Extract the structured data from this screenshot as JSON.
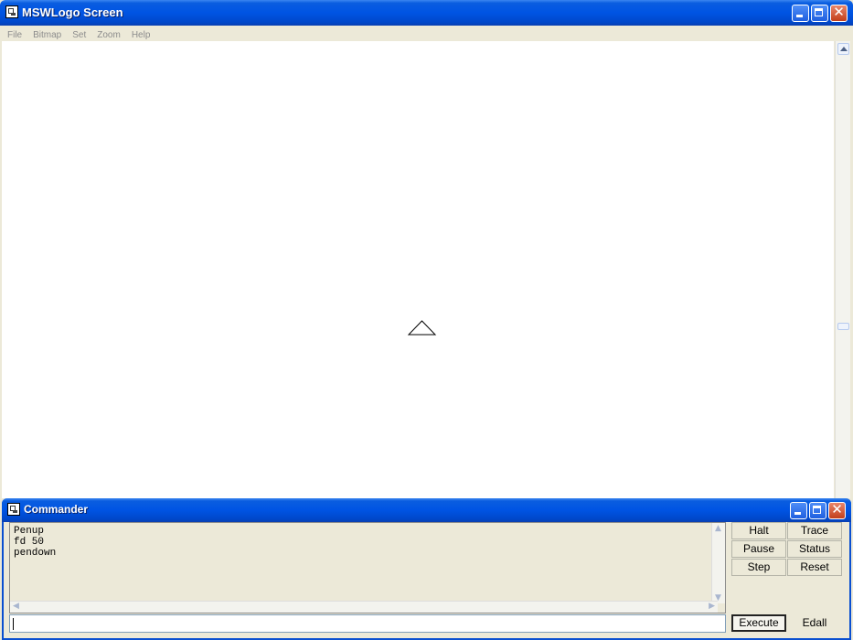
{
  "main_window": {
    "title": "MSWLogo Screen",
    "menu": [
      "File",
      "Bitmap",
      "Set",
      "Zoom",
      "Help"
    ]
  },
  "commander": {
    "title": "Commander",
    "history": [
      "Penup",
      "fd 50",
      "pendown"
    ],
    "input_value": "",
    "buttons": {
      "halt": "Halt",
      "trace": "Trace",
      "pause": "Pause",
      "status": "Status",
      "step": "Step",
      "reset": "Reset",
      "execute": "Execute",
      "edall": "Edall"
    }
  },
  "icons": [
    "app-icon",
    "minimize-icon",
    "maximize-icon",
    "close-icon",
    "scroll-up-icon",
    "turtle-icon"
  ]
}
